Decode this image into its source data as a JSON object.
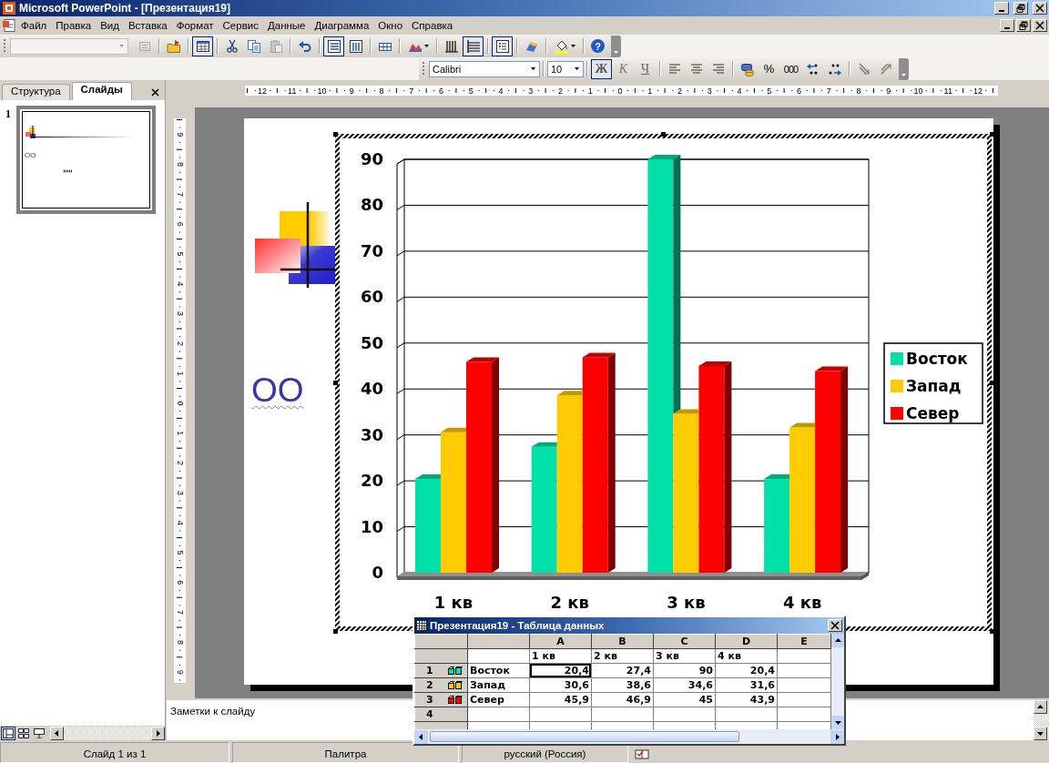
{
  "window": {
    "title": "Microsoft PowerPoint - [Презентация19]"
  },
  "menu": {
    "items": [
      "Файл",
      "Правка",
      "Вид",
      "Вставка",
      "Формат",
      "Сервис",
      "Данные",
      "Диаграмма",
      "Окно",
      "Справка"
    ]
  },
  "chart_toolbar": {
    "object_selector": {
      "disabled": true
    },
    "groups": [
      [
        {
          "kind": "format",
          "pressed": false,
          "disabled": true
        }
      ],
      [
        {
          "kind": "import",
          "pressed": false,
          "disabled": false
        }
      ],
      [
        {
          "kind": "datasheet",
          "pressed": true,
          "disabled": false
        }
      ],
      [
        {
          "kind": "cut",
          "pressed": false,
          "disabled": false
        },
        {
          "kind": "copy",
          "pressed": false,
          "disabled": false
        },
        {
          "kind": "paste",
          "pressed": false,
          "disabled": true
        }
      ],
      [
        {
          "kind": "undo",
          "pressed": false,
          "disabled": false
        }
      ],
      [
        {
          "kind": "by_rows",
          "pressed": true,
          "disabled": false
        },
        {
          "kind": "by_columns",
          "pressed": false,
          "disabled": false
        }
      ],
      [
        {
          "kind": "data_table",
          "pressed": false,
          "disabled": false
        }
      ],
      [
        {
          "kind": "chart_type",
          "pressed": false,
          "disabled": false
        }
      ],
      [
        {
          "kind": "category_gridlines",
          "pressed": false,
          "disabled": false
        },
        {
          "kind": "value_gridlines",
          "pressed": true,
          "disabled": false
        }
      ],
      [
        {
          "kind": "legend",
          "pressed": true,
          "disabled": false
        }
      ],
      [
        {
          "kind": "drawing",
          "pressed": false,
          "disabled": false
        }
      ],
      [
        {
          "kind": "fill_color",
          "pressed": false,
          "disabled": false
        }
      ],
      [
        {
          "kind": "help",
          "label": "?",
          "pressed": false,
          "disabled": false
        }
      ]
    ]
  },
  "formatting_toolbar": {
    "font": "Calibri",
    "size": "10",
    "groups": [
      [
        {
          "kind": "bold",
          "label": "Ж",
          "pressed": true
        },
        {
          "kind": "italic",
          "label": "К",
          "pressed": false
        },
        {
          "kind": "underline",
          "label": "Ч",
          "pressed": false
        }
      ],
      [
        {
          "kind": "align_left",
          "pressed": false
        },
        {
          "kind": "align_center",
          "pressed": false
        },
        {
          "kind": "align_right",
          "pressed": false
        }
      ],
      [
        {
          "kind": "currency",
          "pressed": false
        },
        {
          "kind": "percent",
          "label": "%",
          "pressed": false
        },
        {
          "kind": "thousands",
          "label": "000",
          "pressed": false
        },
        {
          "kind": "increase_decimal",
          "pressed": false
        },
        {
          "kind": "decrease_decimal",
          "pressed": false
        }
      ],
      [
        {
          "kind": "angle_down",
          "pressed": false
        },
        {
          "kind": "angle_up",
          "pressed": false
        }
      ]
    ]
  },
  "task_pane": {
    "tabs": [
      {
        "label": "Структура",
        "selected": false
      },
      {
        "label": "Слайды",
        "selected": true
      }
    ],
    "slides": [
      {
        "number": "1",
        "selected": true,
        "thumbnail_text": "OO"
      }
    ]
  },
  "rulers": {
    "horizontal": [
      "12",
      "11",
      "10",
      "9",
      "8",
      "7",
      "6",
      "5",
      "4",
      "3",
      "2",
      "1",
      "0",
      "1",
      "2",
      "3",
      "4",
      "5",
      "6",
      "7",
      "8",
      "9",
      "10",
      "11",
      "12"
    ],
    "vertical": [
      "9",
      "8",
      "7",
      "6",
      "5",
      "4",
      "3",
      "2",
      "1",
      "0",
      "1",
      "2",
      "3",
      "4",
      "5",
      "6",
      "7",
      "8",
      "9"
    ]
  },
  "slide": {
    "text": "OO",
    "spelling_error": true,
    "chart": {
      "selected": true,
      "chart_data": {
        "type": "bar",
        "categories": [
          "1 кв",
          "2 кв",
          "3 кв",
          "4 кв"
        ],
        "series": [
          {
            "name": "Восток",
            "color": "#00e0a8",
            "values": [
              20.4,
              27.4,
              90,
              20.4
            ]
          },
          {
            "name": "Запад",
            "color": "#ffcc00",
            "values": [
              30.6,
              38.6,
              34.6,
              31.6
            ]
          },
          {
            "name": "Север",
            "color": "#ff0000",
            "values": [
              45.9,
              46.9,
              45,
              43.9
            ]
          }
        ],
        "ylim": [
          0,
          90
        ],
        "grid": true,
        "legend": "right",
        "yticks": [
          0,
          10,
          20,
          30,
          40,
          50,
          60,
          70,
          80,
          90
        ]
      }
    }
  },
  "notes": {
    "placeholder": "Заметки к слайду"
  },
  "status_bar": {
    "sections": [
      "Слайд 1 из 1",
      "Палитра",
      "русский (Россия)"
    ]
  },
  "datasheet": {
    "title": "Презентация19 - Таблица данных",
    "columns": [
      "A",
      "B",
      "C",
      "D",
      "E"
    ],
    "categories": [
      "1 кв",
      "2 кв",
      "3 кв",
      "4 кв"
    ],
    "rows": [
      {
        "number": "1",
        "name": "Восток",
        "color": "#00e0a8",
        "cells": [
          {
            "text": "20,4",
            "selected": true
          },
          {
            "text": "27,4",
            "selected": false
          },
          {
            "text": "90",
            "selected": false
          },
          {
            "text": "20,4",
            "selected": false
          }
        ]
      },
      {
        "number": "2",
        "name": "Запад",
        "color": "#ffcc00",
        "cells": [
          {
            "text": "30,6",
            "selected": false
          },
          {
            "text": "38,6",
            "selected": false
          },
          {
            "text": "34,6",
            "selected": false
          },
          {
            "text": "31,6",
            "selected": false
          }
        ]
      },
      {
        "number": "3",
        "name": "Север",
        "color": "#ff0000",
        "cells": [
          {
            "text": "45,9",
            "selected": false
          },
          {
            "text": "46,9",
            "selected": false
          },
          {
            "text": "45",
            "selected": false
          },
          {
            "text": "43,9",
            "selected": false
          }
        ]
      },
      {
        "number": "4"
      }
    ]
  }
}
